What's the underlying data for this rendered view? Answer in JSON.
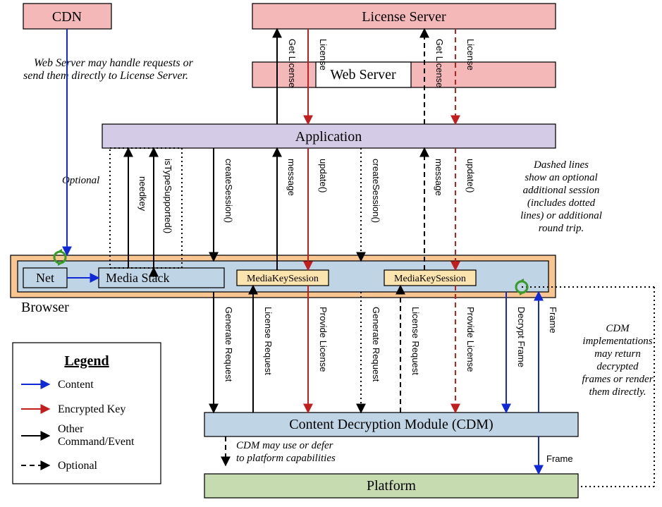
{
  "boxes": {
    "cdn": "CDN",
    "license_server": "License Server",
    "web_server": "Web Server",
    "application": "Application",
    "browser": "Browser",
    "net": "Net",
    "media_stack": "Media Stack",
    "mks1": "MediaKeySession",
    "mks2": "MediaKeySession",
    "cdm": "Content Decryption Module (CDM)",
    "platform": "Platform"
  },
  "notes": {
    "web_server_note_l1": "Web Server may handle requests or",
    "web_server_note_l2": "send them directly to License Server.",
    "optional": "Optional",
    "dashed_l1": "Dashed lines",
    "dashed_l2": "show an optional",
    "dashed_l3": "additional session",
    "dashed_l4": "(includes dotted",
    "dashed_l5": "lines) or additional",
    "dashed_l6": "round trip.",
    "cdm_impl_l1": "CDM",
    "cdm_impl_l2": "implementations",
    "cdm_impl_l3": "may return",
    "cdm_impl_l4": "decrypted",
    "cdm_impl_l5": "frames or render",
    "cdm_impl_l6": "them directly.",
    "cdm_platform_l1": "CDM may use or defer",
    "cdm_platform_l2": "to platform capabilities"
  },
  "labels": {
    "get_license": "Get License",
    "license": "License",
    "needkey": "needkey",
    "isTypeSupported": "isTypeSupported()",
    "createSession": "createSession()",
    "message": "message",
    "update": "update()",
    "generate_request": "Generate Request",
    "license_request": "License Request",
    "provide_license": "Provide License",
    "decrypt_frame": "Decrypt Frame",
    "frame": "Frame"
  },
  "legend": {
    "title": "Legend",
    "content": "Content",
    "encrypted_key": "Encrypted Key",
    "other_l1": "Other",
    "other_l2": "Command/Event",
    "optional": "Optional"
  }
}
